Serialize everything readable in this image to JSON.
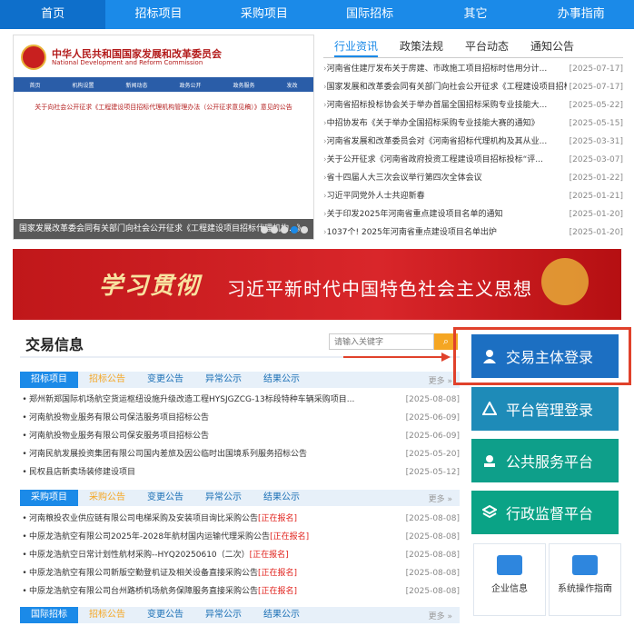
{
  "nav": {
    "items": [
      "首页",
      "招标项目",
      "采购项目",
      "国际招标",
      "其它",
      "办事指南"
    ]
  },
  "slide": {
    "org_cn": "中华人民共和国国家发展和改革委员会",
    "org_en": "National Development and Reform Commission",
    "bar_items": [
      "首页",
      "机构设置",
      "新闻动态",
      "政务公开",
      "政务服务",
      "发改"
    ],
    "doc_title": "关于向社会公开征求《工程建设项目招标代理机构管理办法（公开征求意见稿）》意见的公告",
    "caption": "国家发展改革委会同有关部门向社会公开征求《工程建设项目招标代理机构...》"
  },
  "news": {
    "tabs": [
      "行业资讯",
      "政策法规",
      "平台动态",
      "通知公告"
    ],
    "items": [
      {
        "title": "河南省住建厅发布关于房建、市政施工项目招标时信用分计...",
        "date": "[2025-07-17]"
      },
      {
        "title": "国家发展和改革委会同有关部门向社会公开征求《工程建设项目招标...",
        "date": "[2025-07-17]"
      },
      {
        "title": "河南省招标投标协会关于举办首届全国招标采购专业技能大...",
        "date": "[2025-05-22]"
      },
      {
        "title": "中招协发布《关于举办全国招标采购专业技能大赛的通知》",
        "date": "[2025-05-15]"
      },
      {
        "title": "河南省发展和改革委员会对《河南省招标代理机构及其从业...",
        "date": "[2025-03-31]"
      },
      {
        "title": "关于公开征求《河南省政府投资工程建设项目招标投标“评...",
        "date": "[2025-03-07]"
      },
      {
        "title": "省十四届人大三次会议举行第四次全体会议",
        "date": "[2025-01-22]"
      },
      {
        "title": "习近平同党外人士共迎新春",
        "date": "[2025-01-21]"
      },
      {
        "title": "关于印发2025年河南省重点建设项目名单的通知",
        "date": "[2025-01-20]"
      },
      {
        "title": "1037个! 2025年河南省重点建设项目名单出炉",
        "date": "[2025-01-20]"
      }
    ]
  },
  "banner": {
    "lead": "学习贯彻",
    "main": "习近平新时代中国特色社会主义思想"
  },
  "trade": {
    "title": "交易信息",
    "search_placeholder": "请输入关键字",
    "more": "更多 »",
    "bid_tabs": [
      "招标项目",
      "招标公告",
      "变更公告",
      "异常公示",
      "结果公示"
    ],
    "bid_items": [
      {
        "title": "郑州新郑国际机场航空货运枢纽设施升级改造工程HYSJGZCG-13标段特种车辆采购项目...",
        "tag": "",
        "date": "[2025-08-08]"
      },
      {
        "title": "河南航投物业服务有限公司保洁服务项目招标公告",
        "tag": "",
        "date": "[2025-06-09]"
      },
      {
        "title": "河南航投物业服务有限公司保安服务项目招标公告",
        "tag": "",
        "date": "[2025-06-09]"
      },
      {
        "title": "河南民航发展投资集团有限公司国内差旅及因公临时出国境系列服务招标公告",
        "tag": "",
        "date": "[2025-05-20]"
      },
      {
        "title": "民权县店新卖场装修建设项目",
        "tag": "",
        "date": "[2025-05-12]"
      }
    ],
    "purchase_tabs": [
      "采购项目",
      "采购公告",
      "变更公告",
      "异常公示",
      "结果公示"
    ],
    "purchase_items": [
      {
        "title": "河南粮投农业供应链有限公司电梯采购及安装项目询比采购公告",
        "tag": "[正在报名]",
        "date": "[2025-08-08]"
      },
      {
        "title": "中原龙浩航空有限公司2025年-2028年航材国内运输代理采购公告",
        "tag": "[正在报名]",
        "date": "[2025-08-08]"
      },
      {
        "title": "中原龙浩航空日常计划性航材采购--HYQ20250610（二次）",
        "tag": "[正在报名]",
        "date": "[2025-08-08]"
      },
      {
        "title": "中原龙浩航空有限公司新版空勤登机证及相关设备直接采购公告",
        "tag": "[正在报名]",
        "date": "[2025-08-08]"
      },
      {
        "title": "中原龙浩航空有限公司台州路桥机场航务保障服务直接采购公告",
        "tag": "[正在报名]",
        "date": "[2025-08-08]"
      }
    ],
    "intl_tabs": [
      "国际招标",
      "招标公告",
      "变更公告",
      "异常公示",
      "结果公示"
    ]
  },
  "side": {
    "buttons": [
      "交易主体登录",
      "平台管理登录",
      "公共服务平台",
      "行政监督平台"
    ],
    "tiles": [
      "企业信息",
      "系统操作指南"
    ]
  },
  "colors": {
    "primary": "#1b8ae8",
    "accent": "#f5a623",
    "alert": "#e0201b"
  }
}
